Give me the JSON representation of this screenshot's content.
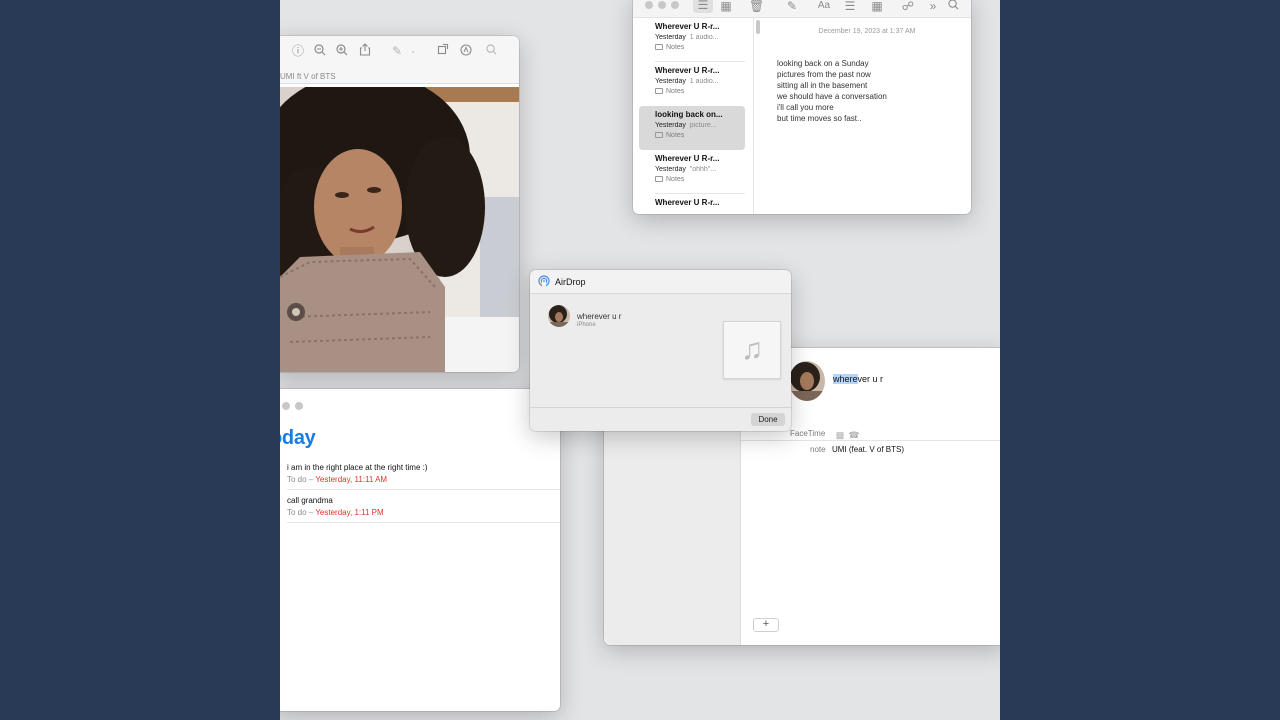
{
  "preview": {
    "subtitle": "UMI ft V of BTS",
    "toolbar_icons": [
      "info-icon",
      "zoom-out-icon",
      "zoom-in-icon",
      "share-icon",
      "markup-pen-icon",
      "chevron-down-icon",
      "rotate-icon",
      "annotate-icon",
      "search-icon"
    ]
  },
  "notes": {
    "items": [
      {
        "title": "Wherever U R-r...",
        "date": "Yesterday",
        "preview": "1 audio...",
        "folder": "Notes",
        "selected": false
      },
      {
        "title": "Wherever U R-r...",
        "date": "Yesterday",
        "preview": "1 audio...",
        "folder": "Notes",
        "selected": false
      },
      {
        "title": "looking back on...",
        "date": "Yesterday",
        "preview": "picture...",
        "folder": "Notes",
        "selected": true
      },
      {
        "title": "Wherever U R-r...",
        "date": "Yesterday",
        "preview": "\"ohhh\"...",
        "folder": "Notes",
        "selected": false
      },
      {
        "title": "Wherever U R-r...",
        "date": "",
        "preview": "",
        "folder": "",
        "selected": false
      }
    ],
    "editor": {
      "date": "December 19, 2023 at 1:37 AM",
      "lines": [
        "looking back on a Sunday",
        "pictures from the past now",
        "sitting all in the basement",
        "we should have a conversation",
        "i'll call you more",
        "but time moves so fast.."
      ]
    }
  },
  "reminders": {
    "title": "oday",
    "items": [
      {
        "text": "i am in the right place at the right time :)",
        "list": "To do",
        "sep": " – ",
        "date": "Yesterday, 11:11 AM"
      },
      {
        "text": "call grandma",
        "list": "To do",
        "sep": " – ",
        "date": "Yesterday, 1:11 PM"
      }
    ]
  },
  "airdrop": {
    "title": "AirDrop",
    "recipient_name": "wherever u r",
    "recipient_device": "iPhone",
    "file_icon": "music-note-icon",
    "done_label": "Done"
  },
  "contacts": {
    "name_highlight": "where",
    "name_rest": "ver u r",
    "facetime_label": "FaceTime",
    "note_label": "note",
    "note_value": "UMI (feat. V of BTS)",
    "add_label": "+"
  },
  "colors": {
    "accent_blue": "#1a7be0",
    "reminder_date_red": "#e0322a",
    "desktop_bg": "#283a55"
  }
}
